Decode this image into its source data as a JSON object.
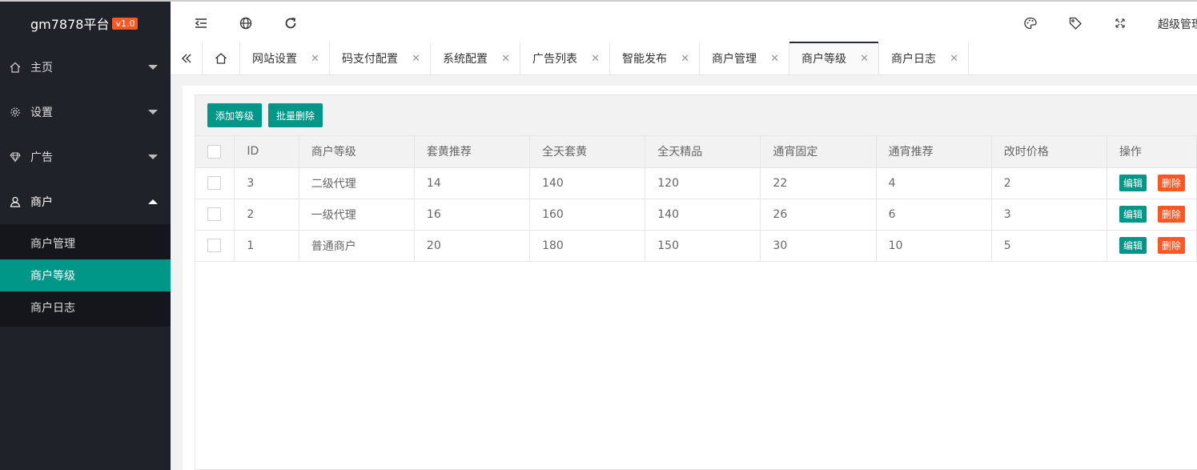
{
  "app": {
    "name": "gm7878平台",
    "version": "v1.0"
  },
  "sidebar": {
    "menus": [
      {
        "label": "主页",
        "icon": "home-icon"
      },
      {
        "label": "设置",
        "icon": "gear-icon"
      },
      {
        "label": "广告",
        "icon": "diamond-icon"
      },
      {
        "label": "商户",
        "icon": "user-icon"
      }
    ],
    "sub_items": [
      {
        "label": "商户管理"
      },
      {
        "label": "商户等级"
      },
      {
        "label": "商户日志"
      }
    ]
  },
  "header": {
    "admin": "超级管理"
  },
  "tabs": [
    {
      "label": "网站设置"
    },
    {
      "label": "码支付配置"
    },
    {
      "label": "系统配置"
    },
    {
      "label": "广告列表"
    },
    {
      "label": "智能发布"
    },
    {
      "label": "商户管理"
    },
    {
      "label": "商户等级"
    },
    {
      "label": "商户日志"
    }
  ],
  "toolbar": {
    "add_label": "添加等级",
    "batch_delete_label": "批量删除"
  },
  "table": {
    "columns": [
      "ID",
      "商户等级",
      "套黄推荐",
      "全天套黄",
      "全天精品",
      "通宵固定",
      "通宵推荐",
      "改时价格",
      "操作"
    ],
    "rows": [
      [
        "3",
        "二级代理",
        "14",
        "140",
        "120",
        "22",
        "4",
        "2"
      ],
      [
        "2",
        "一级代理",
        "16",
        "160",
        "140",
        "26",
        "6",
        "3"
      ],
      [
        "1",
        "普通商户",
        "20",
        "180",
        "150",
        "30",
        "10",
        "5"
      ]
    ],
    "edit_label": "编辑",
    "delete_label": "删除"
  },
  "colors": {
    "accent": "#009688",
    "danger": "#ff5722",
    "sidebar": "#20222a"
  }
}
